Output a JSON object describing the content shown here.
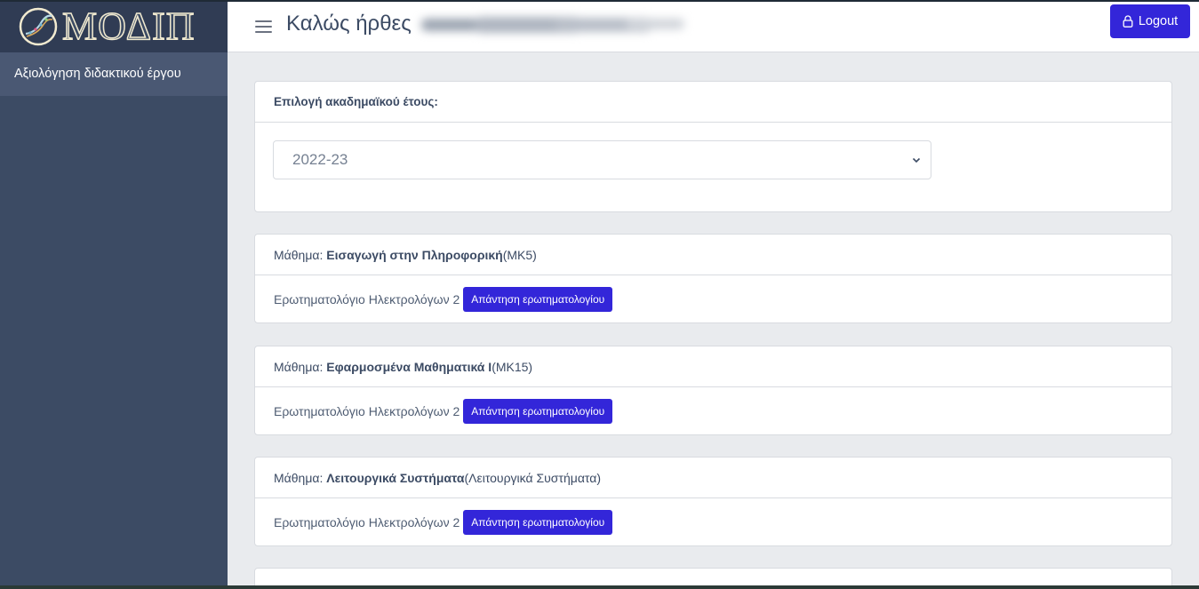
{
  "brand": {
    "logo_text": "ΜΟΔΙΠ"
  },
  "sidebar": {
    "items": [
      {
        "label": "Αξιολόγηση διδακτικού έργου"
      }
    ]
  },
  "header": {
    "welcome": "Καλώς ήρθες",
    "logout_label": "Logout"
  },
  "year_selector": {
    "title": "Επιλογή ακαδημαϊκού έτους:",
    "selected": "2022-23"
  },
  "courses": [
    {
      "prefix": "Μάθημα:",
      "name": "Εισαγωγή στην Πληροφορική",
      "code": "(ΜΚ5)",
      "questionnaire": "Ερωτηματολόγιο Ηλεκτρολόγων 2",
      "button": "Απάντηση ερωτηματολογίου"
    },
    {
      "prefix": "Μάθημα:",
      "name": "Εφαρμοσμένα Μαθηματικά Ι",
      "code": "(ΜΚ15)",
      "questionnaire": "Ερωτηματολόγιο Ηλεκτρολόγων 2",
      "button": "Απάντηση ερωτηματολογίου"
    },
    {
      "prefix": "Μάθημα:",
      "name": "Λειτουργικά Συστήματα",
      "code": "(Λειτουργικά Συστήματα)",
      "questionnaire": "Ερωτηματολόγιο Ηλεκτρολόγων 2",
      "button": "Απάντηση ερωτηματολογίου"
    }
  ],
  "colors": {
    "sidebar": "#3c4b64",
    "accent": "#3326d9",
    "background": "#e9ebee"
  },
  "icons": {
    "logout": "lock-icon",
    "menu": "hamburger-icon",
    "select": "chevron-down-icon"
  }
}
